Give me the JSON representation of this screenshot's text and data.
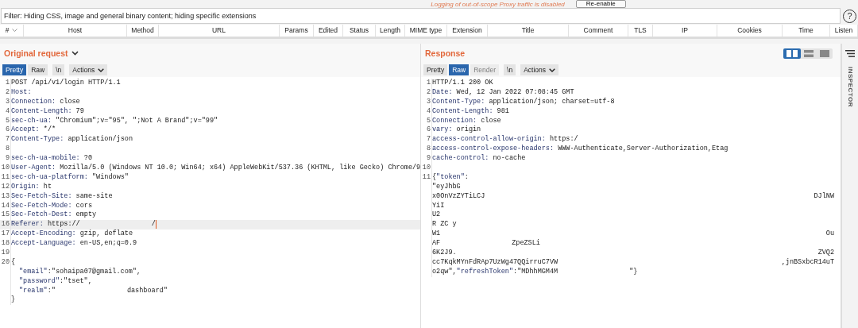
{
  "notice": {
    "text": "Logging of out-of-scope Proxy traffic is disabled",
    "button": "Re-enable"
  },
  "filter": {
    "text": "Filter: Hiding CSS, image and general binary content;  hiding specific extensions",
    "help": "?"
  },
  "table": {
    "columns": [
      {
        "label": "#",
        "sortable": true
      },
      {
        "label": "Host",
        "sortable": false
      },
      {
        "label": "Method",
        "sortable": false
      },
      {
        "label": "URL",
        "sortable": false
      },
      {
        "label": "Params",
        "sortable": false
      },
      {
        "label": "Edited",
        "sortable": false
      },
      {
        "label": "Status",
        "sortable": false
      },
      {
        "label": "Length",
        "sortable": false
      },
      {
        "label": "MIME type",
        "sortable": false
      },
      {
        "label": "Extension",
        "sortable": false
      },
      {
        "label": "Title",
        "sortable": false
      },
      {
        "label": "Comment",
        "sortable": false
      },
      {
        "label": "TLS",
        "sortable": false
      },
      {
        "label": "IP",
        "sortable": false
      },
      {
        "label": "Cookies",
        "sortable": false
      },
      {
        "label": "Time",
        "sortable": false
      },
      {
        "label": "Listen",
        "sortable": false
      }
    ]
  },
  "panels": [
    {
      "title": "Original request",
      "dropdown": true,
      "layout_toggle": false,
      "tabs": [
        {
          "label": "Pretty",
          "selected": true,
          "disabled": false,
          "kind": "tab"
        },
        {
          "label": "Raw",
          "selected": false,
          "disabled": false,
          "kind": "tab"
        },
        {
          "label": "\\n",
          "selected": false,
          "disabled": false,
          "kind": "tab"
        },
        {
          "label": "Actions",
          "selected": false,
          "disabled": false,
          "kind": "menu"
        }
      ],
      "lines": [
        {
          "num": "1",
          "text": "POST /api/v1/login HTTP/1.1"
        },
        {
          "num": "2",
          "key": "Host:"
        },
        {
          "num": "3",
          "key": "Connection:",
          "value": " close"
        },
        {
          "num": "4",
          "key": "Content-Length:",
          "value": " 79"
        },
        {
          "num": "5",
          "key": "sec-ch-ua:",
          "value": " \"Chromium\";v=\"95\", \";Not A Brand\";v=\"99\""
        },
        {
          "num": "6",
          "key": "Accept:",
          "value": " */*"
        },
        {
          "num": "7",
          "key": "Content-Type:",
          "value": " application/json"
        },
        {
          "num": "8"
        },
        {
          "num": "9",
          "key": "sec-ch-ua-mobile:",
          "value": " ?0"
        },
        {
          "num": "10",
          "key": "User-Agent:",
          "value": " Mozilla/5.0 (Windows NT 10.0; Win64; x64) AppleWebKit/537.36 (KHTML, like Gecko) Chrome/9"
        },
        {
          "num": "11",
          "key": "sec-ch-ua-platform:",
          "value": " \"Windows\""
        },
        {
          "num": "12",
          "key": "Origin:",
          "value": " ht"
        },
        {
          "num": "13",
          "key": "Sec-Fetch-Site:",
          "value": " same-site"
        },
        {
          "num": "14",
          "key": "Sec-Fetch-Mode:",
          "value": " cors"
        },
        {
          "num": "15",
          "key": "Sec-Fetch-Dest:",
          "value": " empty"
        },
        {
          "num": "16",
          "key": "Referer:",
          "value": " https://",
          "after": "/",
          "current": true
        },
        {
          "num": "17",
          "key": "Accept-Encoding:",
          "value": " gzip, deflate"
        },
        {
          "num": "18",
          "key": "Accept-Language:",
          "value": " en-US,en;q=0.9"
        },
        {
          "num": "19"
        },
        {
          "num": "20",
          "text": "{"
        },
        {
          "kind": "nested",
          "key": "\"email\"",
          "value": ":\"sohaipa07@gmail.com\","
        },
        {
          "kind": "nested",
          "key": "\"password\"",
          "value": ":\"tset\","
        },
        {
          "kind": "nested",
          "key": "\"realm\"",
          "value": ":\"",
          "after": "dashboard\""
        },
        {
          "text": "}"
        }
      ]
    },
    {
      "title": "Response",
      "dropdown": false,
      "layout_toggle": true,
      "tabs": [
        {
          "label": "Pretty",
          "selected": false,
          "disabled": false,
          "kind": "tab"
        },
        {
          "label": "Raw",
          "selected": true,
          "disabled": false,
          "kind": "tab"
        },
        {
          "label": "Render",
          "selected": false,
          "disabled": true,
          "kind": "tab"
        },
        {
          "label": "\\n",
          "selected": false,
          "disabled": false,
          "kind": "tab"
        },
        {
          "label": "Actions",
          "selected": false,
          "disabled": false,
          "kind": "menu"
        }
      ],
      "lines": [
        {
          "num": "1",
          "text": "HTTP/1.1 200 OK"
        },
        {
          "num": "2",
          "key": "Date:",
          "value": " Wed, 12 Jan 2022 07:08:45 GMT"
        },
        {
          "num": "3",
          "key": "Content-Type:",
          "value": " application/json; charset=utf-8"
        },
        {
          "num": "4",
          "key": "Content-Length:",
          "value": " 981"
        },
        {
          "num": "5",
          "key": "Connection:",
          "value": " close"
        },
        {
          "num": "6",
          "key": "vary:",
          "value": " origin"
        },
        {
          "num": "7",
          "key": "access-control-allow-origin:",
          "value": " https:/"
        },
        {
          "num": "8",
          "key": "access-control-expose-headers:",
          "value": " WWW-Authenticate,Server-Authorization,Etag"
        },
        {
          "num": "9",
          "key": "cache-control:",
          "value": " no-cache"
        },
        {
          "num": "10"
        },
        {
          "num": "11",
          "text": "{",
          "key": "\"token\"",
          "value": ":"
        },
        {
          "text": "\"eyJhbG"
        },
        {
          "text": "x0OnVzZYTiLCJ",
          "tail": "DJlNW"
        },
        {
          "text": "YiI"
        },
        {
          "text": "U2"
        },
        {
          "text": "R ZC y"
        },
        {
          "text": "W1",
          "tail": "Ou"
        },
        {
          "text": "AF",
          "after": "ZpeZSLi"
        },
        {
          "text": "6K2J9.",
          "tail": "ZVQ2"
        },
        {
          "text": "cc7KqkMYnFdRAp7UzWg47QQirruC7VW",
          "tail": ",jnBSxbcR14uT"
        },
        {
          "text": "o2qw\",",
          "key": "\"refreshToken\"",
          "value": ":\"MDhhMGM4M",
          "after": "\"}"
        }
      ]
    }
  ],
  "inspector": {
    "label": "INSPECTOR"
  }
}
